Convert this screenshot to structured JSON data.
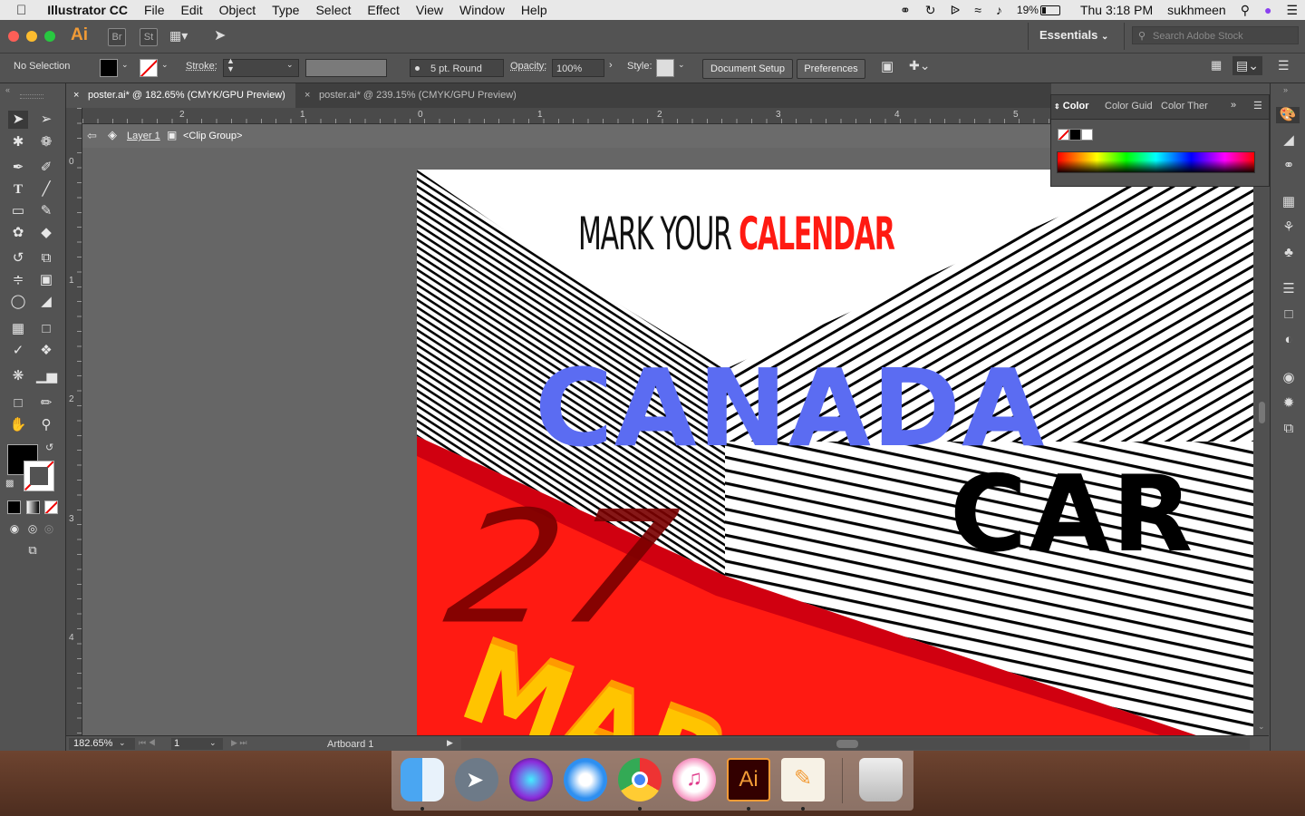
{
  "menubar": {
    "app_name": "Illustrator CC",
    "menus": [
      "File",
      "Edit",
      "Object",
      "Type",
      "Select",
      "Effect",
      "View",
      "Window",
      "Help"
    ],
    "battery": "19%",
    "clock": "Thu 3:18 PM",
    "user": "sukhmeen"
  },
  "appbar": {
    "logo": "Ai",
    "bridge_label": "Br",
    "stock_label": "St",
    "workspace": "Essentials",
    "stock_search_placeholder": "Search Adobe Stock"
  },
  "control": {
    "selection": "No Selection",
    "stroke_label": "Stroke:",
    "brush": "5 pt. Round",
    "opacity_label": "Opacity:",
    "opacity_value": "100%",
    "style_label": "Style:",
    "document_setup": "Document Setup",
    "preferences": "Preferences"
  },
  "tabs": [
    {
      "label": "poster.ai* @ 182.65% (CMYK/GPU Preview)",
      "active": true
    },
    {
      "label": "poster.ai* @ 239.15% (CMYK/GPU Preview)",
      "active": false
    }
  ],
  "isolation": {
    "layer": "Layer 1",
    "group": "<Clip Group>"
  },
  "rulers": {
    "h_ticks": [
      "2",
      "1",
      "0",
      "1",
      "2",
      "3",
      "4",
      "5"
    ],
    "v_ticks": [
      "0",
      "1",
      "2",
      "3",
      "4"
    ]
  },
  "color_panel": {
    "tabs": [
      "Color",
      "Color Guid",
      "Color Ther"
    ]
  },
  "artwork": {
    "headline_thin": "MARK YOUR",
    "headline_bold": "CALENDAR",
    "country": "CANADA",
    "word2": "CAR",
    "day": "27",
    "month": "MARC",
    "colors": {
      "blue": "#5b6cf2",
      "red": "#ff1a12",
      "dark_red": "#d00010",
      "yellow": "#ffd000",
      "orange": "#ff9a00"
    }
  },
  "status": {
    "zoom": "182.65%",
    "page": "1",
    "artboard": "Artboard 1"
  },
  "dock": {
    "apps": [
      "Finder",
      "Launchpad",
      "Siri",
      "Safari",
      "Chrome",
      "iTunes",
      "Illustrator",
      "Pages",
      "Trash"
    ],
    "illustrator_label": "Ai"
  }
}
